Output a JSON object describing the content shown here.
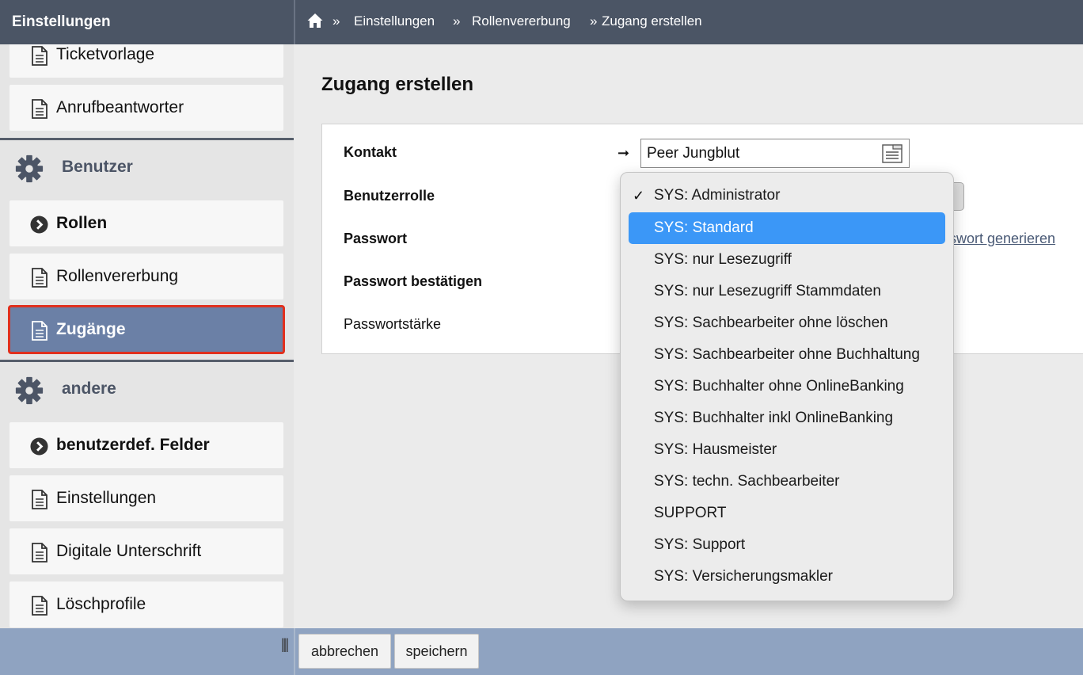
{
  "header": {
    "sidebar_title": "Einstellungen",
    "breadcrumb": [
      {
        "sep": "»",
        "label": "Einstellungen"
      },
      {
        "sep": "»",
        "label": "Rollenvererbung"
      },
      {
        "sep": "»",
        "label": "Zugang erstellen"
      }
    ]
  },
  "sidebar": {
    "items_top": [
      {
        "label": "Ticketvorlage",
        "icon": "document-icon"
      },
      {
        "label": "Anrufbeantworter",
        "icon": "document-icon"
      }
    ],
    "section_benutzer": {
      "label": "Benutzer",
      "icon": "gear-icon"
    },
    "benutzer_items": [
      {
        "label": "Rollen",
        "icon": "arrow-circle-icon"
      },
      {
        "label": "Rollenvererbung",
        "icon": "document-icon"
      },
      {
        "label": "Zugänge",
        "icon": "document-icon",
        "active": true
      }
    ],
    "section_andere": {
      "label": "andere",
      "icon": "gear-icon"
    },
    "andere_items": [
      {
        "label": "benutzerdef. Felder",
        "icon": "arrow-circle-icon"
      },
      {
        "label": "Einstellungen",
        "icon": "document-icon"
      },
      {
        "label": "Digitale Unterschrift",
        "icon": "document-icon"
      },
      {
        "label": "Löschprofile",
        "icon": "document-icon"
      }
    ],
    "resize_handle": "|||"
  },
  "main": {
    "title": "Zugang erstellen",
    "form": {
      "kontakt_label": "Kontakt",
      "kontakt_value": "Peer Jungblut",
      "rolle_label": "Benutzerrolle",
      "passwort_label": "Passwort",
      "passwort_confirm_label": "Passwort bestätigen",
      "passwortstaerke_label": "Passwortstärke",
      "generate_link": "sswort generieren",
      "required_arrow": "➞"
    },
    "dropdown": {
      "checked_option": "SYS: Administrator",
      "highlighted_option": "SYS: Standard",
      "options": [
        "SYS: Administrator",
        "SYS: Standard",
        "SYS: nur Lesezugriff",
        "SYS: nur Lesezugriff Stammdaten",
        "SYS: Sachbearbeiter ohne löschen",
        "SYS: Sachbearbeiter ohne Buchhaltung",
        "SYS: Buchhalter ohne OnlineBanking",
        "SYS: Buchhalter inkl OnlineBanking",
        "SYS: Hausmeister",
        "SYS: techn. Sachbearbeiter",
        "SUPPORT",
        "SYS: Support",
        "SYS: Versicherungsmakler"
      ],
      "checkmark": "✓"
    }
  },
  "footer": {
    "cancel_label": "abbrechen",
    "save_label": "speichern"
  },
  "colors": {
    "header_bg": "#4b5565",
    "active_item_bg": "#6b80a6",
    "active_outline": "#e0301e",
    "footer_bg": "#8fa3c1",
    "dropdown_highlight": "#3b97f7"
  }
}
